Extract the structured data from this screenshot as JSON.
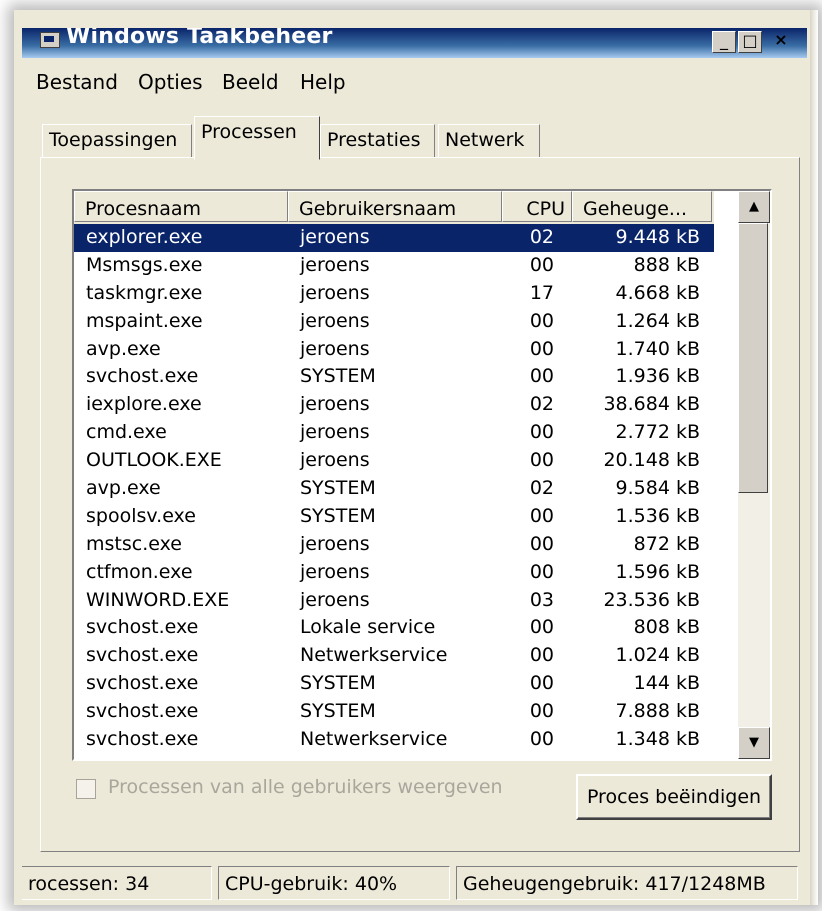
{
  "window": {
    "title": "Windows Taakbeheer",
    "minimize_glyph": "_",
    "maximize_glyph": "□",
    "close_glyph": "×"
  },
  "menu": [
    "Bestand",
    "Opties",
    "Beeld",
    "Help"
  ],
  "tabs": [
    {
      "label": "Toepassingen",
      "active": false
    },
    {
      "label": "Processen",
      "active": true
    },
    {
      "label": "Prestaties",
      "active": false
    },
    {
      "label": "Netwerk",
      "active": false
    }
  ],
  "process_table": {
    "columns": [
      "Procesnaam",
      "Gebruikersnaam",
      "CPU",
      "Geheuge..."
    ],
    "rows": [
      {
        "name": "explorer.exe",
        "user": "jeroens",
        "cpu": "02",
        "mem": "9.448 kB",
        "selected": true
      },
      {
        "name": "Msmsgs.exe",
        "user": "jeroens",
        "cpu": "00",
        "mem": "888 kB"
      },
      {
        "name": "taskmgr.exe",
        "user": "jeroens",
        "cpu": "17",
        "mem": "4.668 kB"
      },
      {
        "name": "mspaint.exe",
        "user": "jeroens",
        "cpu": "00",
        "mem": "1.264 kB"
      },
      {
        "name": "avp.exe",
        "user": "jeroens",
        "cpu": "00",
        "mem": "1.740 kB"
      },
      {
        "name": "svchost.exe",
        "user": "SYSTEM",
        "cpu": "00",
        "mem": "1.936 kB"
      },
      {
        "name": "iexplore.exe",
        "user": "jeroens",
        "cpu": "02",
        "mem": "38.684 kB"
      },
      {
        "name": "cmd.exe",
        "user": "jeroens",
        "cpu": "00",
        "mem": "2.772 kB"
      },
      {
        "name": "OUTLOOK.EXE",
        "user": "jeroens",
        "cpu": "00",
        "mem": "20.148 kB"
      },
      {
        "name": "avp.exe",
        "user": "SYSTEM",
        "cpu": "02",
        "mem": "9.584 kB"
      },
      {
        "name": "spoolsv.exe",
        "user": "SYSTEM",
        "cpu": "00",
        "mem": "1.536 kB"
      },
      {
        "name": "mstsc.exe",
        "user": "jeroens",
        "cpu": "00",
        "mem": "872 kB"
      },
      {
        "name": "ctfmon.exe",
        "user": "jeroens",
        "cpu": "00",
        "mem": "1.596 kB"
      },
      {
        "name": "WINWORD.EXE",
        "user": "jeroens",
        "cpu": "03",
        "mem": "23.536 kB"
      },
      {
        "name": "svchost.exe",
        "user": "Lokale service",
        "cpu": "00",
        "mem": "808 kB"
      },
      {
        "name": "svchost.exe",
        "user": "Netwerkservice",
        "cpu": "00",
        "mem": "1.024 kB"
      },
      {
        "name": "svchost.exe",
        "user": "SYSTEM",
        "cpu": "00",
        "mem": "144 kB"
      },
      {
        "name": "svchost.exe",
        "user": "SYSTEM",
        "cpu": "00",
        "mem": "7.888 kB"
      },
      {
        "name": "svchost.exe",
        "user": "Netwerkservice",
        "cpu": "00",
        "mem": "1.348 kB"
      }
    ]
  },
  "scrollbar": {
    "up_glyph": "▲",
    "down_glyph": "▼"
  },
  "show_all_users": {
    "label": "Processen van alle gebruikers weergeven",
    "checked": false,
    "enabled": false
  },
  "end_process_button": "Proces beëindigen",
  "statusbar": {
    "processes": "rocessen: 34",
    "cpu": "CPU-gebruik: 40%",
    "memory": "Geheugengebruik: 417/1248MB"
  },
  "colors": {
    "selection": "#0a246a",
    "titlebar": "#0a246a",
    "chrome": "#ece9d8"
  }
}
